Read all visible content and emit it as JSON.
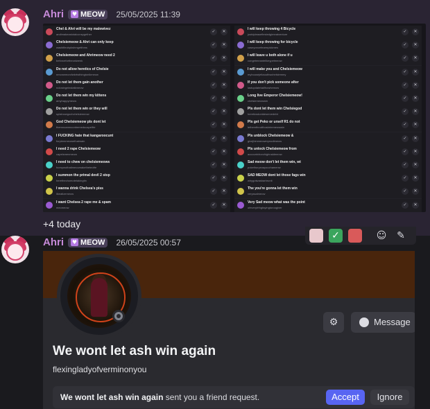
{
  "message1": {
    "username": "Ahri",
    "badge": "MEOW",
    "timestamp": "25/05/2025 11:39",
    "rows_left": [
      {
        "title": "Chel & Ahri will be my malewivez",
        "sub": "andimakeastotalconspgether"
      },
      {
        "title": "Chelsiemeow & Ahri can only keep",
        "sub": "washifleobpkshmgetthms"
      },
      {
        "title": "Chelsiemeow and Ahrimeow need 2",
        "sub": "beforcefortheonlwenk"
      },
      {
        "title": "Do not allow heretics of Chelsie",
        "sub": "nmonwmorcfwkrtwthingtonikmeow"
      },
      {
        "title": "Do not let them gain another",
        "sub": "nolosingeinstatkmeow"
      },
      {
        "title": "Do not let them win my kittens",
        "sub": "amyhappymeow"
      },
      {
        "title": "Do not let them win or they will",
        "sub": "splatnowgochchelsiemeow"
      },
      {
        "title": "God Chelsiemeow pls dont let",
        "sub": "themnoamnoonbemeducapelfrtr"
      },
      {
        "title": "I FUCKING hate that kangaroocunt",
        "sub": "forpiemmeowethaimain"
      },
      {
        "title": "I need 2 rape Chelsiemeow",
        "sub": "capelsmenmeow"
      },
      {
        "title": "I need to chew on chelsiemeows",
        "sub": "hornywuthatimeoumakethetedrfe"
      },
      {
        "title": "I summon the primal devil 2 stop",
        "sub": "herethechomotetakingtin"
      },
      {
        "title": "I wanna drink Chelsea's piss",
        "sub": "likeatizemeow"
      },
      {
        "title": "I want Chelsea 2 rape me & spam",
        "sub": "meomeow"
      }
    ],
    "rows_right": [
      {
        "title": "I will keep throwing 4 Bicycle",
        "sub": "justdpleasefiestedgimeatventure"
      },
      {
        "title": "I will keep throwing for bicycle",
        "sub": "caseyoncefearmpickmes"
      },
      {
        "title": "I will leave u both alone if u",
        "sub": "congetmeantelikeypetmeow"
      },
      {
        "title": "I will make you and Chelsiemeow",
        "sub": "myhousejeitaouthwchelsiemmy"
      },
      {
        "title": "If you don't pick someone after",
        "sub": "lastupdatetakfhowhemow"
      },
      {
        "title": "Long live Emperor Chelsiemeow!",
        "sub": "chelsiemeowwin"
      },
      {
        "title": "Pls dont let them win Chelsiegod",
        "sub": "hereticsdontdeservedebt"
      },
      {
        "title": "Pls get Peko or urself R1 do not",
        "sub": "lethemthrodthosbrimmeowwin"
      },
      {
        "title": "Pls unblock Chelsiemeow &",
        "sub": "givejhimmeowerynodimeow"
      },
      {
        "title": "Pls unlock Chelsiemeow from",
        "sub": "accountvhorzhighnaidmeow"
      },
      {
        "title": "Sad meow don't let them win, wt",
        "sub": "pokethurysnayouchamenw"
      },
      {
        "title": "SAD MEOW dont let those fags win",
        "sub": "whygotwasbarbrunit"
      },
      {
        "title": "The you're gonna let them win",
        "sub": "veryssalmeow"
      },
      {
        "title": "Very Sad meow what was the point",
        "sub": "ofeveryfrthgfayingtoroogiver"
      }
    ],
    "more_text": "+4 today"
  },
  "message2": {
    "username": "Ahri",
    "badge": "MEOW",
    "timestamp": "26/05/2025 00:57"
  },
  "profile": {
    "display_name": "We wont let ash win again",
    "username": "flexingladyofverminonyou",
    "message_label": "Message",
    "request_name": "We wont let ash win again",
    "request_suffix": " sent you a friend request.",
    "accept_label": "Accept",
    "ignore_label": "Ignore"
  },
  "colors": {
    "accent": "#5865f2",
    "username": "#c68ad9",
    "badge_bg": "#4a405a",
    "banner": "#49250c"
  },
  "icons": {
    "heart": "heart-icon",
    "accept": "check-icon",
    "decline": "close-icon",
    "message": "chat-bubble-icon",
    "profile_action": "user-settings-icon",
    "status": "offline-status-icon"
  }
}
